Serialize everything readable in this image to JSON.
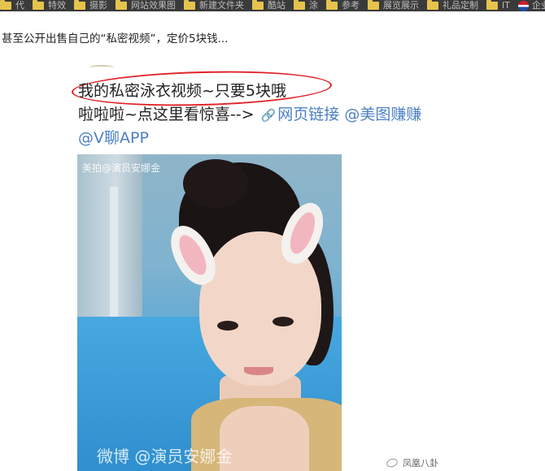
{
  "bookmarks": [
    {
      "label": "代",
      "icon": "folder-icon"
    },
    {
      "label": "特效",
      "icon": "folder-icon"
    },
    {
      "label": "摄影",
      "icon": "folder-icon"
    },
    {
      "label": "网站效果图",
      "icon": "folder-icon"
    },
    {
      "label": "新建文件夹",
      "icon": "folder-icon"
    },
    {
      "label": "酷站",
      "icon": "folder-icon"
    },
    {
      "label": "涂",
      "icon": "folder-icon"
    },
    {
      "label": "参考",
      "icon": "folder-icon"
    },
    {
      "label": "展览展示",
      "icon": "folder-icon"
    },
    {
      "label": "礼品定制",
      "icon": "folder-icon"
    },
    {
      "label": "IT",
      "icon": "folder-icon"
    },
    {
      "label": "企业",
      "icon": "pepsi-icon"
    }
  ],
  "article": {
    "line": "甚至公开出售自己的“私密视频”，定价5块钱..."
  },
  "post": {
    "line1": "我的私密泳衣视频~只要5块哦",
    "line2_prefix": "啦啦啦~点这里看惊喜-->",
    "line2_link": "网页链接",
    "line2_mention": "@美图赚赚",
    "line3": "@V聊APP",
    "photo_tag": "美拍@演员安娜金",
    "photo_watermark": "微博 @演员安娜金"
  },
  "source": {
    "label": "凤凰八卦"
  },
  "colors": {
    "highlight_ellipse": "#e0232a",
    "link": "#4b7fc4",
    "bookmark_bar": "#3a3a3a"
  }
}
